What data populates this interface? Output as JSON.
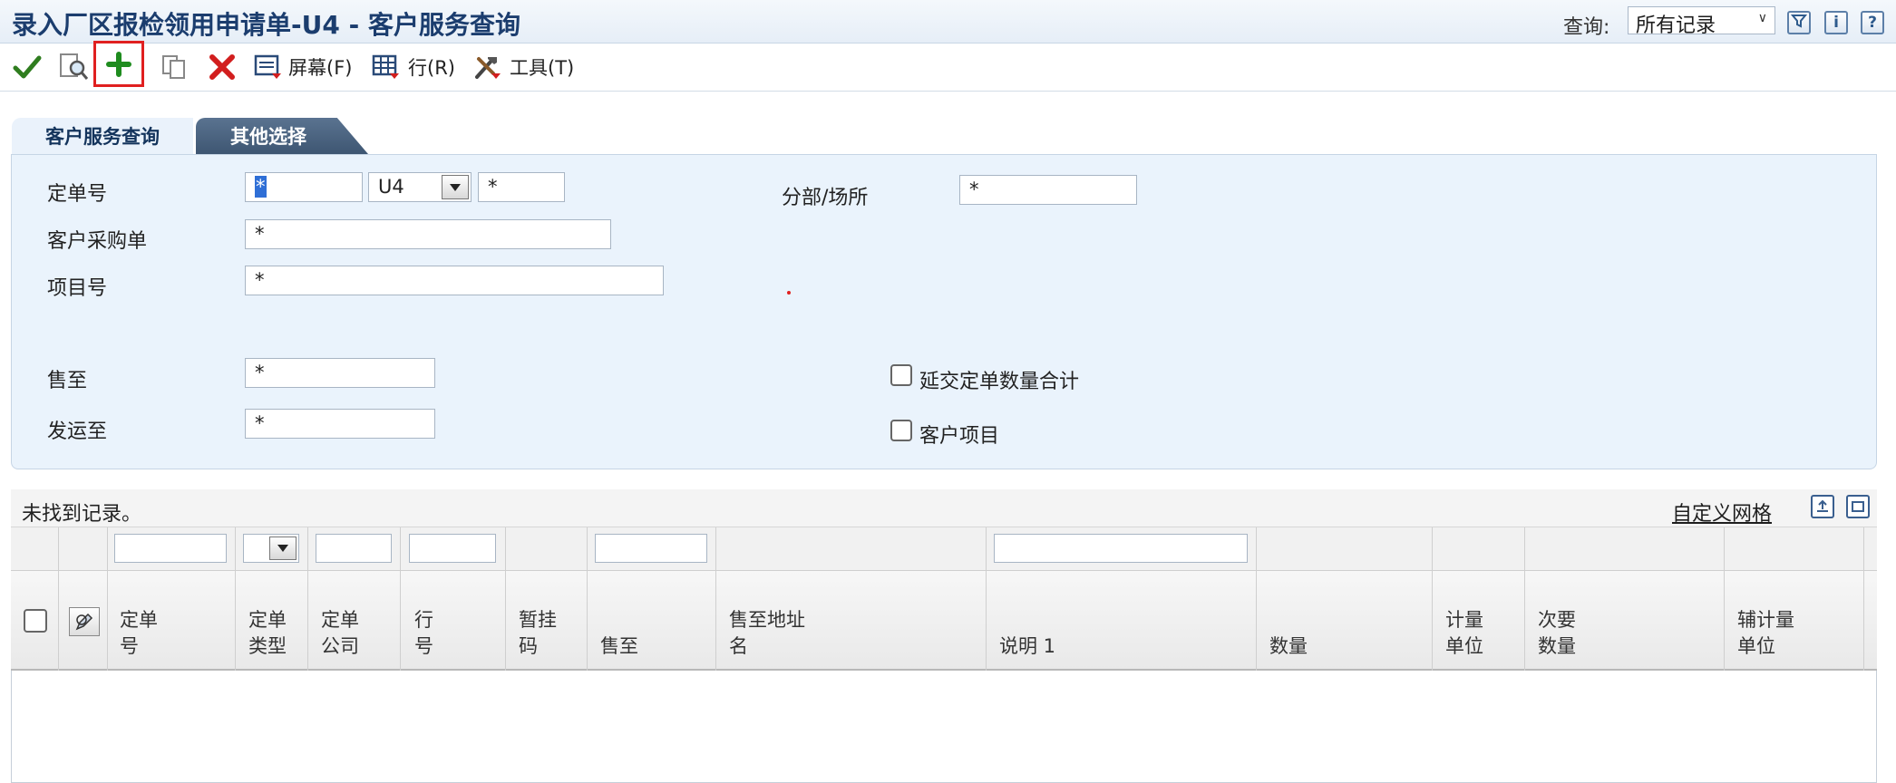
{
  "window": {
    "title": "录入厂区报检领用申请单-U4 - 客户服务查询",
    "query_label": "查询:",
    "query_value": "所有记录",
    "icons": [
      "filter-icon",
      "info-icon",
      "help-icon"
    ]
  },
  "toolbar": {
    "buttons": [
      "ok",
      "find",
      "add",
      "copy",
      "delete"
    ],
    "screen_label": "屏幕(F)",
    "row_label": "行(R)",
    "tools_label": "工具(T)"
  },
  "tabs": {
    "active": "客户服务查询",
    "other": "其他选择"
  },
  "form": {
    "order_no_label": "定单号",
    "order_no_value": "*",
    "order_type_value": "U4",
    "order_company_value": "*",
    "branch_label": "分部/场所",
    "branch_value": "*",
    "customer_po_label": "客户采购单",
    "customer_po_value": "*",
    "item_no_label": "项目号",
    "item_no_value": "*",
    "sold_to_label": "售至",
    "sold_to_value": "*",
    "ship_to_label": "发运至",
    "ship_to_value": "*",
    "deferred_total_label": "延交定单数量合计",
    "customer_item_label": "客户项目"
  },
  "grid": {
    "status": "未找到记录。",
    "customize_label": "自定义网格",
    "columns": [
      {
        "line1": "定单",
        "line2": "号"
      },
      {
        "line1": "定单",
        "line2": "类型"
      },
      {
        "line1": "定单",
        "line2": "公司"
      },
      {
        "line1": "行",
        "line2": "号"
      },
      {
        "line1": "暂挂",
        "line2": "码"
      },
      {
        "line1": "",
        "line2": "售至"
      },
      {
        "line1": "售至地址",
        "line2": "名"
      },
      {
        "line1": "",
        "line2": "说明 1"
      },
      {
        "line1": "",
        "line2": "数量"
      },
      {
        "line1": "计量",
        "line2": "单位"
      },
      {
        "line1": "次要",
        "line2": "数量"
      },
      {
        "line1": "辅计量",
        "line2": "单位"
      }
    ]
  }
}
